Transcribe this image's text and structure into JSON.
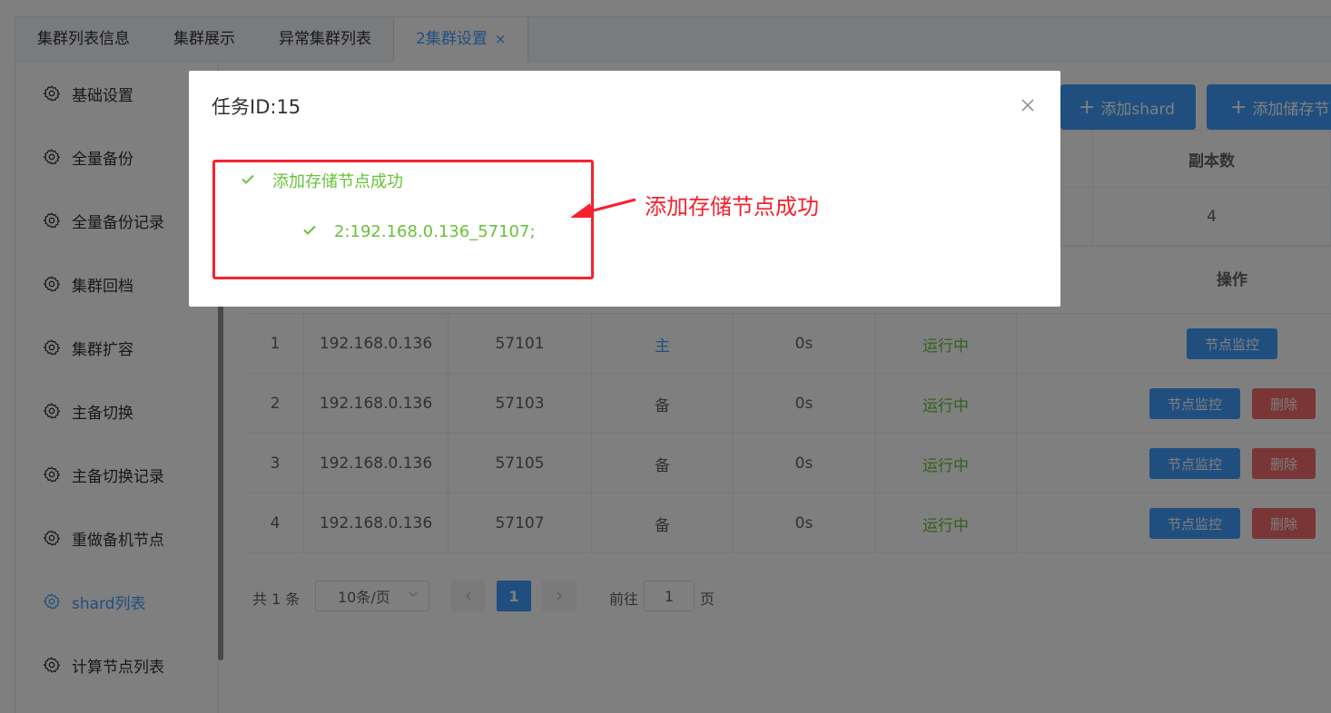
{
  "tabs": [
    {
      "label": "集群列表信息"
    },
    {
      "label": "集群展示"
    },
    {
      "label": "异常集群列表"
    },
    {
      "label": "2集群设置",
      "close": "×"
    }
  ],
  "sidebar": {
    "items": [
      {
        "label": "基础设置"
      },
      {
        "label": "全量备份"
      },
      {
        "label": "全量备份记录"
      },
      {
        "label": "集群回档"
      },
      {
        "label": "集群扩容"
      },
      {
        "label": "主备切换"
      },
      {
        "label": "主备切换记录"
      },
      {
        "label": "重做备机节点"
      },
      {
        "label": "shard列表"
      },
      {
        "label": "计算节点列表"
      }
    ]
  },
  "toolbar": {
    "add_shard_label": "添加shard",
    "add_storage_label": "添加储存节",
    "plus": "+"
  },
  "summary": {
    "replica_header": "副本数",
    "replica_value": "4"
  },
  "nodes": {
    "op_header": "操作",
    "monitor_label": "节点监控",
    "delete_label": "删除",
    "rows": [
      {
        "id": "1",
        "ip": "192.168.0.136",
        "port": "57101",
        "role": "主",
        "delay": "0s",
        "status": "运行中"
      },
      {
        "id": "2",
        "ip": "192.168.0.136",
        "port": "57103",
        "role": "备",
        "delay": "0s",
        "status": "运行中"
      },
      {
        "id": "3",
        "ip": "192.168.0.136",
        "port": "57105",
        "role": "备",
        "delay": "0s",
        "status": "运行中"
      },
      {
        "id": "4",
        "ip": "192.168.0.136",
        "port": "57107",
        "role": "备",
        "delay": "0s",
        "status": "运行中"
      }
    ]
  },
  "pagination": {
    "total": "共 1 条",
    "page_size": "10条/页",
    "current_page": "1",
    "goto_label": "前往",
    "goto_value": "1",
    "page_suffix": "页"
  },
  "dialog": {
    "title": "任务ID:15",
    "result_main": "添加存储节点成功",
    "result_detail": "2:192.168.0.136_57107;"
  },
  "annotation": {
    "text": "添加存储节点成功"
  },
  "colors": {
    "primary": "#409eff",
    "success": "#67c23a",
    "danger": "#f56c6c",
    "annotation": "#f5222d"
  }
}
